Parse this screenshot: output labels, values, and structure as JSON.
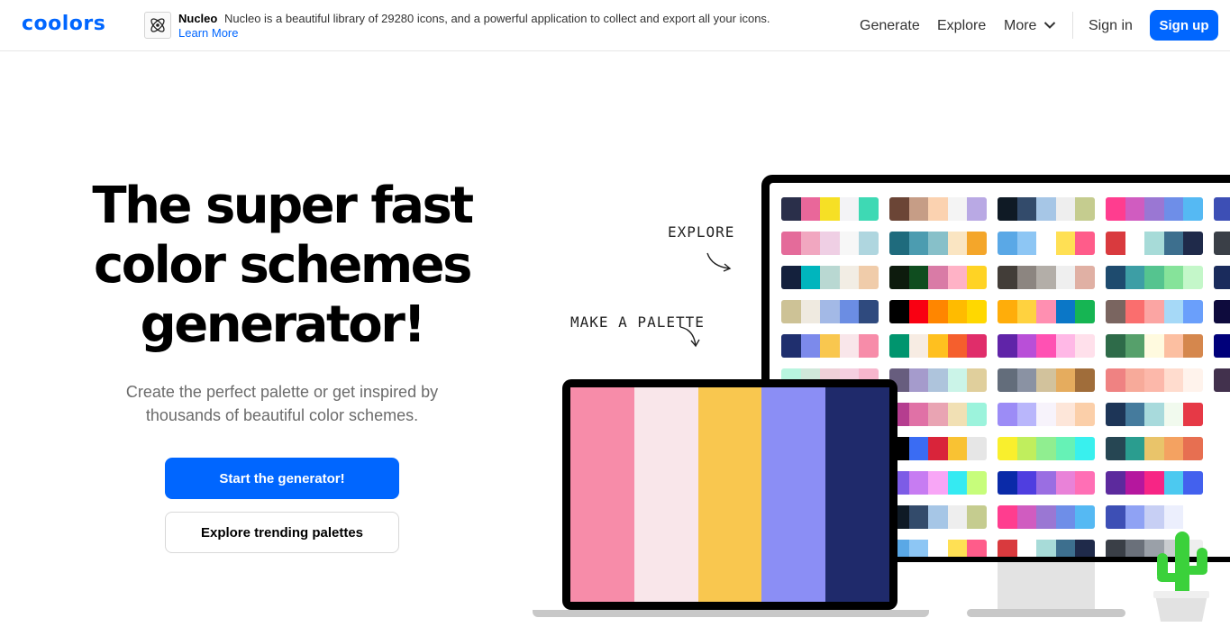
{
  "header": {
    "logo": "coolors",
    "ad": {
      "name": "Nucleo",
      "description": "Nucleo is a beautiful library of 29280 icons, and a powerful application to collect and export all your icons.",
      "link": "Learn More"
    },
    "nav": {
      "generate": "Generate",
      "explore": "Explore",
      "more": "More",
      "signin": "Sign in",
      "signup": "Sign up"
    }
  },
  "hero": {
    "title_line1": "The super fast",
    "title_line2": "color schemes",
    "title_line3": "generator!",
    "subtitle": "Create the perfect palette or get inspired by thousands of beautiful color schemes.",
    "primary_button": "Start the generator!",
    "secondary_button": "Explore trending palettes"
  },
  "illustration": {
    "label_explore": "EXPLORE",
    "label_make": "MAKE A PALETTE",
    "laptop_palette": [
      "#f78ca9",
      "#f9e6ea",
      "#f9c74f",
      "#8b8ef5",
      "#1f2a6b"
    ],
    "monitor_palettes": [
      [
        [
          "#2a2f4a",
          "#e9679a",
          "#f6e025",
          "#f3f3f6",
          "#3ed9b4"
        ],
        [
          "#6b4536",
          "#c69d86",
          "#fbd2b0",
          "#f4f4f4",
          "#b9a9e4"
        ],
        [
          "#0f1a25",
          "#334b6b",
          "#a6c6e6",
          "#eeeeee",
          "#c5cc8f"
        ],
        [
          "#ff3d8f",
          "#d05cc0",
          "#9a77d3",
          "#6e8ee8",
          "#55b9f3"
        ],
        [
          "#3d4fb5",
          "#8fa2f4",
          "#c7cff4",
          "#eceffd",
          "#ffffff"
        ]
      ],
      [
        [
          "#e46b9a",
          "#f1a7c0",
          "#efcfe4",
          "#f7f7f7",
          "#afd6df"
        ],
        [
          "#1f6b7d",
          "#4c9cb0",
          "#87c0c9",
          "#fae5c2",
          "#f4a62a"
        ],
        [
          "#5aa8e6",
          "#8dc6f4",
          "#ffffff",
          "#ffe054",
          "#ff5c8a"
        ],
        [
          "#d93a3e",
          "#ffffff",
          "#a7dbd8",
          "#3d6f8e",
          "#1f2a4a"
        ],
        [
          "#3a3f47",
          "#6a707a",
          "#9aa0a8",
          "#c9ccd0",
          "#eeeeee"
        ]
      ],
      [
        [
          "#14213d",
          "#00b5bd",
          "#b9d8d2",
          "#f2ede4",
          "#f0ccaa"
        ],
        [
          "#0d1b0d",
          "#0f4d1f",
          "#d97ba6",
          "#ffb2c6",
          "#ffd324"
        ],
        [
          "#423d38",
          "#8c8580",
          "#b3aea8",
          "#efefef",
          "#e0b0a4"
        ],
        [
          "#1e4b6e",
          "#3d9ea5",
          "#55c48f",
          "#86e39a",
          "#c4f7c9"
        ],
        [
          "#1a2b5c",
          "#3f5ba9",
          "#6d8ce0",
          "#a3b9f4",
          "#dfe6fc"
        ]
      ],
      [
        [
          "#cdc296",
          "#efeae0",
          "#a3b9e6",
          "#6b8de3",
          "#2f4a7e"
        ],
        [
          "#000000",
          "#f90012",
          "#ff8600",
          "#ffbb00",
          "#ffd800"
        ],
        [
          "#ffad0a",
          "#ffd23f",
          "#ff8fb1",
          "#0b77c7",
          "#16b553"
        ],
        [
          "#7a6560",
          "#fa6e6e",
          "#fba5a3",
          "#a6d9f7",
          "#6a9ffb"
        ],
        [
          "#0e0b3d",
          "#262173",
          "#4a3fb0",
          "#7d6ee8",
          "#c0b7ff"
        ]
      ],
      [
        [
          "#1f2f6e",
          "#7c8aeb",
          "#f9c74f",
          "#f9e6ea",
          "#f78ca9"
        ],
        [
          "#00956e",
          "#f7ece3",
          "#ffc01f",
          "#f55f2d",
          "#e02d6a"
        ],
        [
          "#6024a8",
          "#b94fd8",
          "#ff51b3",
          "#ffb8e6",
          "#ffe0eb"
        ],
        [
          "#2e6b49",
          "#56a06b",
          "#fffadf",
          "#fcbfa1",
          "#d5874d"
        ],
        [
          "#00007a",
          "#0d21a8",
          "#3a5fe5",
          "#8fb0fb",
          "#e6eeff"
        ]
      ],
      [
        [
          "#b8f5df",
          "#d0e8da",
          "#efd0d7",
          "#f5cfe0",
          "#f7b6cd"
        ],
        [
          "#675d7e",
          "#a59bcc",
          "#aec4dc",
          "#cbf4e8",
          "#e0cf9c"
        ],
        [
          "#636d7b",
          "#8a92a3",
          "#d2c29c",
          "#e5ac5e",
          "#a06d3a"
        ],
        [
          "#ef8282",
          "#f7aa9a",
          "#fcb8aa",
          "#ffdcce",
          "#fff3ec"
        ],
        [
          "#42314d",
          "#6b5876",
          "#9d8aa3",
          "#c9bbc8",
          "#f5eef1"
        ]
      ],
      [
        [
          "#e2426a",
          "#e89ba0",
          "#d9b4bf",
          "#dfe1f5",
          "#9ff5f2"
        ],
        [
          "#b53d8f",
          "#e071a6",
          "#e9a4b3",
          "#f1e0b4",
          "#9cf3dc"
        ],
        [
          "#9c8cf6",
          "#b9b6fb",
          "#f7f3fb",
          "#fde6d9",
          "#fbcfa9"
        ],
        [
          "#1d3557",
          "#457b9d",
          "#a8dadc",
          "#f1faee",
          "#e63946"
        ]
      ],
      [
        [
          "#1e8ed6",
          "#2ec0d4",
          "#f9a826",
          "#f9c74f",
          "#4f7a28"
        ],
        [
          "#000000",
          "#3a6cf3",
          "#d9243a",
          "#f9c233",
          "#e6e6e6"
        ],
        [
          "#f9ef2d",
          "#c0ee5d",
          "#90ee90",
          "#66f2b6",
          "#39f0ee"
        ],
        [
          "#264653",
          "#2a9d8f",
          "#e9c46a",
          "#f4a261",
          "#e76f51"
        ]
      ],
      [
        [
          "#2a5fd9",
          "#3ba4f0",
          "#a6dff5",
          "#fff203",
          "#ffc700"
        ],
        [
          "#7d5ce6",
          "#c77cf2",
          "#f8a6f6",
          "#35eaf2",
          "#c7fd7b"
        ],
        [
          "#0a2aa8",
          "#4f3ee0",
          "#9a6ee2",
          "#e982d8",
          "#ff6fb5"
        ],
        [
          "#5c2a9d",
          "#b5179e",
          "#f72585",
          "#4cc9f0",
          "#4361ee"
        ]
      ],
      [
        [
          "#6b4536",
          "#c69d86",
          "#fbd2b0",
          "#f4f4f4",
          "#b9a9e4"
        ],
        [
          "#0f1a25",
          "#334b6b",
          "#a6c6e6",
          "#eeeeee",
          "#c5cc8f"
        ],
        [
          "#ff3d8f",
          "#d05cc0",
          "#9a77d3",
          "#6e8ee8",
          "#55b9f3"
        ],
        [
          "#3d4fb5",
          "#8fa2f4",
          "#c7cff4",
          "#eceffd",
          "#ffffff"
        ]
      ],
      [
        [
          "#1f6b7d",
          "#4c9cb0",
          "#87c0c9",
          "#fae5c2",
          "#f4a62a"
        ],
        [
          "#5aa8e6",
          "#8dc6f4",
          "#ffffff",
          "#ffe054",
          "#ff5c8a"
        ],
        [
          "#d93a3e",
          "#ffffff",
          "#a7dbd8",
          "#3d6f8e",
          "#1f2a4a"
        ],
        [
          "#3a3f47",
          "#6a707a",
          "#9aa0a8",
          "#c9ccd0",
          "#eeeeee"
        ]
      ]
    ]
  }
}
